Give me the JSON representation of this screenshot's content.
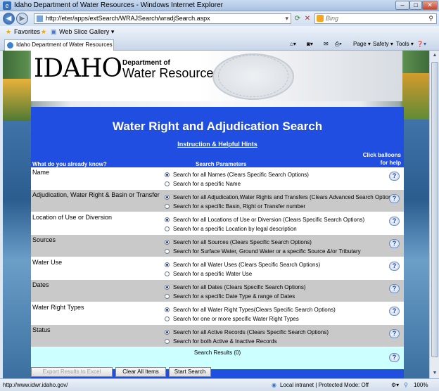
{
  "window": {
    "title": "Idaho Department of Water Resources - Windows Internet Explorer",
    "min": "–",
    "max": "□",
    "close": "✕"
  },
  "address": {
    "url": "http://eter/apps/extSearch/WRAJSearch/wradjSearch.aspx",
    "search_placeholder": "Bing"
  },
  "favorites": {
    "label": "Favorites",
    "web_slice": "Web Slice Gallery ▾"
  },
  "tab": {
    "label": "Idaho Department of Water Resources"
  },
  "commands": {
    "page": "Page ▾",
    "safety": "Safety ▾",
    "tools": "Tools ▾",
    "help": "❓▾"
  },
  "header": {
    "logo": "IDAHO",
    "dept_line1": "Department of",
    "dept_line2": "Water Resources"
  },
  "main": {
    "title": "Water Right and Adjudication Search",
    "hints": "Instruction & Helpful Hints",
    "col_know": "What do you already know?",
    "col_params": "Search Parameters",
    "col_help": "Click balloons for help"
  },
  "rows": [
    {
      "cat": "Name",
      "opt1": "Search for all Names (Clears Specific Search Options)",
      "opt2": "Search for a specific Name"
    },
    {
      "cat": "Adjudication, Water Right & Basin or Transfer",
      "opt1": "Search for all Adjudication,Water Rights and Transfers (Clears Advanced Search Options)",
      "opt2": "Search for a specific Basin, Right or Transfer number"
    },
    {
      "cat": "Location of Use or Diversion",
      "opt1": "Search for all Locations of Use or Diversion (Clears Specific Search Options)",
      "opt2": "Search for a specific Location by legal description"
    },
    {
      "cat": "Sources",
      "opt1": "Search for all Sources (Clears Specific Search Options)",
      "opt2": "Search for Surface Water, Ground Water or a specific Source &/or Tributary"
    },
    {
      "cat": "Water Use",
      "opt1": "Search for all Water Uses (Clears Specific Search Options)",
      "opt2": "Search for a specific Water Use"
    },
    {
      "cat": "Dates",
      "opt1": "Search for all Dates (Clears Specific Search Options)",
      "opt2": "Search for a specific Date Type & range of Dates"
    },
    {
      "cat": "Water Right Types",
      "opt1": "Search for all Water Right Types(Clears Specific Search Options)",
      "opt2": "Search for one or more specific Water Right Types"
    },
    {
      "cat": "Status",
      "opt1": "Search for all Active Records (Clears Specific Search Options)",
      "opt2": "Search for both Active & Inactive Records"
    }
  ],
  "help_glyph": "?",
  "results": {
    "label": "Search Results (0)"
  },
  "buttons": {
    "export": "Export Results to Excel",
    "clear": "Clear All Items",
    "start": "Start Search"
  },
  "status": {
    "url": "http://www.idwr.idaho.gov/",
    "zone": "Local intranet | Protected Mode: Off",
    "zoom": "100%"
  }
}
